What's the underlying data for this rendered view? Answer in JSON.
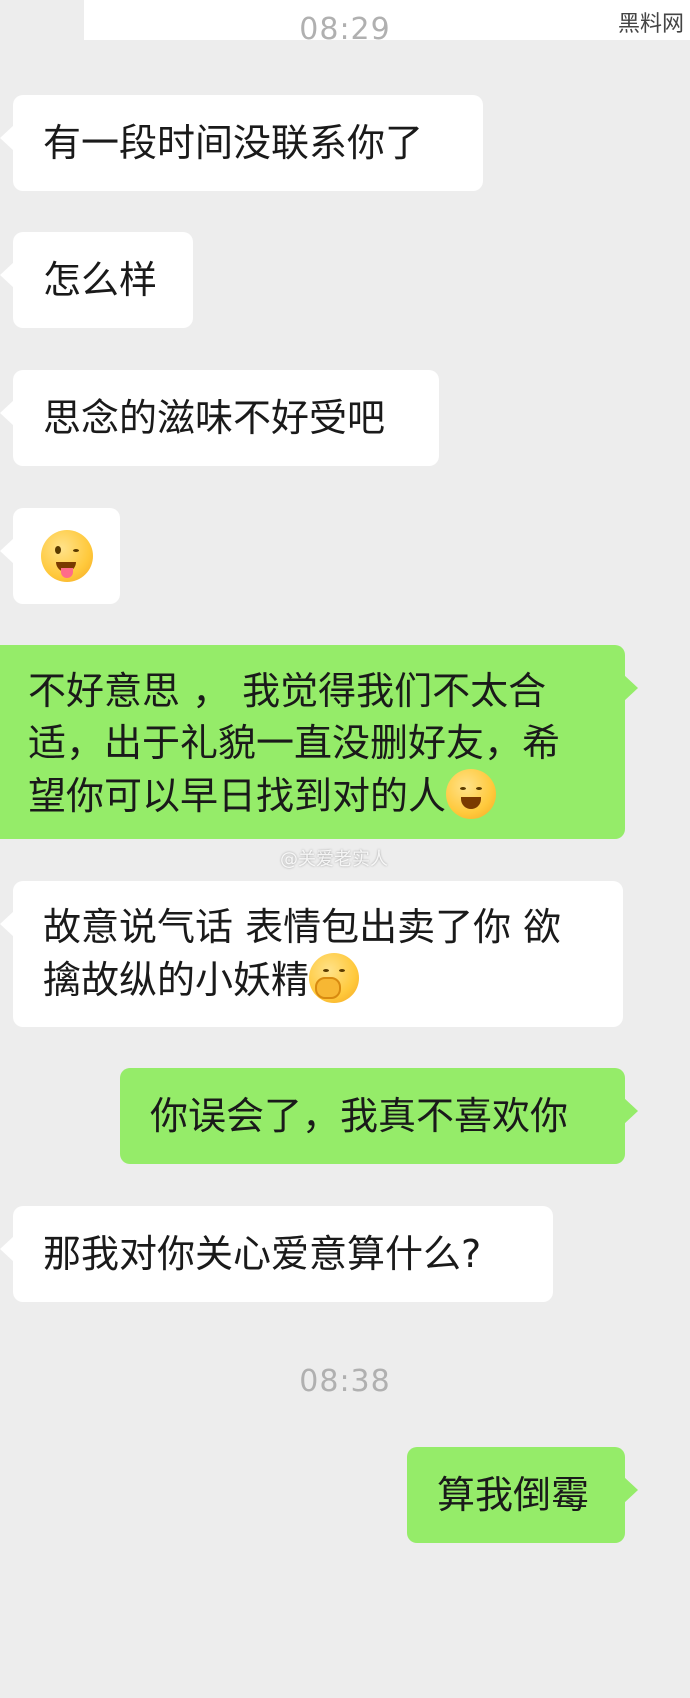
{
  "watermark": "黑料网",
  "weibo_watermark": "@关爱老实人",
  "timestamps": [
    "08:29",
    "08:38"
  ],
  "messages": [
    {
      "side": "in",
      "text": "有一段时间没联系你了"
    },
    {
      "side": "in",
      "text": "怎么样"
    },
    {
      "side": "in",
      "text": "思念的滋味不好受吧"
    },
    {
      "side": "in",
      "emoji": "winking-tongue-emoji"
    },
    {
      "side": "out",
      "line1": "不好意思 ， 我觉得我们不太合",
      "line2": "适，出于礼貌一直没删好友，希",
      "line3": "望你可以早日找到对的人",
      "emoji": "laughing-tears-emoji"
    },
    {
      "side": "in",
      "line1": "故意说气话 表情包出卖了你 欲",
      "line2": "擒故纵的小妖精",
      "emoji": "smirk-emoji"
    },
    {
      "side": "out",
      "text": "你误会了，我真不喜欢你"
    },
    {
      "side": "in",
      "text": "那我对你关心爱意算什么?"
    },
    {
      "side": "out",
      "text": "算我倒霉"
    }
  ]
}
